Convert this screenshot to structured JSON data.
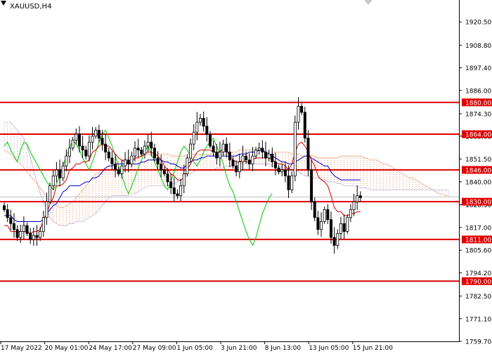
{
  "window": {
    "symbol": "XAUUSD,H4"
  },
  "colors": {
    "background": "#ffffff",
    "axis": "#000000",
    "candle": "#000000",
    "level_line": "#e00000",
    "level_tag_bg": "#e00000",
    "level_tag_text": "#ffffff",
    "current_price_line": "#c0c0c0",
    "current_price_tag_bg": "#e00000",
    "tenkan": "#d00000",
    "kijun": "#0000c8",
    "chikou": "#00c800",
    "senkou_a": "#e89060",
    "senkou_b": "#b098c8"
  },
  "chart_data": {
    "type": "candlestick",
    "title": "XAUUSD,H4",
    "indicator": "Ichimoku Kinko Hyo",
    "ylim": [
      1759.7,
      1928.0
    ],
    "price_ticks": [
      "1920.50",
      "1908.80",
      "1897.40",
      "1886.00",
      "1874.30",
      "1863.00",
      "1851.50",
      "1840.00",
      "1828.50",
      "1817.00",
      "1805.60",
      "1794.20",
      "1782.50",
      "1771.10",
      "1759.70"
    ],
    "time_labels": [
      "17 May 2022",
      "20 May 01:00",
      "24 May 17:00",
      "27 May 09:00",
      "1 Jun 05:00",
      "3 Jun 21:00",
      "8 Jun 13:00",
      "13 Jun 05:00",
      "15 Jun 21:00"
    ],
    "levels": [
      {
        "label": "1880.00",
        "value": 1880.0
      },
      {
        "label": "1864.00",
        "value": 1864.0
      },
      {
        "label": "1846.00",
        "value": 1846.0
      },
      {
        "label": "1830.00",
        "value": 1830.0
      },
      {
        "label": "1811.00",
        "value": 1811.0
      },
      {
        "label": "1790.00",
        "value": 1790.0
      }
    ],
    "current_price": 1832.4,
    "closes": [
      1826,
      1822,
      1819,
      1816,
      1812,
      1815,
      1818,
      1814,
      1811,
      1813,
      1812,
      1815,
      1822,
      1830,
      1838,
      1843,
      1846,
      1842,
      1848,
      1853,
      1857,
      1861,
      1864,
      1858,
      1856,
      1853,
      1860,
      1863,
      1866,
      1862,
      1859,
      1855,
      1852,
      1849,
      1846,
      1844,
      1848,
      1851,
      1849,
      1853,
      1857,
      1856,
      1854,
      1858,
      1860,
      1857,
      1852,
      1849,
      1846,
      1844,
      1840,
      1837,
      1834,
      1833,
      1838,
      1844,
      1852,
      1859,
      1865,
      1870,
      1872,
      1868,
      1864,
      1858,
      1855,
      1852,
      1855,
      1859,
      1855,
      1851,
      1848,
      1845,
      1850,
      1853,
      1851,
      1849,
      1853,
      1856,
      1857,
      1855,
      1852,
      1854,
      1850,
      1847,
      1845,
      1846,
      1843,
      1836,
      1843,
      1870,
      1878,
      1875,
      1862,
      1846,
      1830,
      1822,
      1816,
      1820,
      1826,
      1821,
      1812,
      1808,
      1814,
      1819,
      1815,
      1822,
      1826,
      1830,
      1833,
      1832
    ],
    "tenkan": [
      1818,
      1818,
      1815,
      1815,
      1815,
      1815,
      1815,
      1815,
      1814,
      1815,
      1815,
      1816,
      1821,
      1824,
      1829,
      1832,
      1838,
      1838,
      1839,
      1841,
      1846,
      1847,
      1849,
      1849,
      1850,
      1850,
      1851,
      1855,
      1856,
      1858,
      1859,
      1858,
      1858,
      1856,
      1854,
      1852,
      1851,
      1850,
      1849,
      1850,
      1852,
      1852,
      1853,
      1854,
      1855,
      1855,
      1854,
      1853,
      1851,
      1848,
      1846,
      1844,
      1843,
      1841,
      1841,
      1842,
      1846,
      1849,
      1852,
      1855,
      1856,
      1856,
      1856,
      1856,
      1855,
      1855,
      1855,
      1857,
      1856,
      1853,
      1851,
      1850,
      1850,
      1851,
      1850,
      1850,
      1851,
      1852,
      1852,
      1852,
      1852,
      1852,
      1851,
      1850,
      1849,
      1849,
      1848,
      1846,
      1849,
      1855,
      1859,
      1860,
      1858,
      1855,
      1851,
      1848,
      1843,
      1841,
      1840,
      1838,
      1833,
      1827,
      1825,
      1825,
      1823,
      1823,
      1824,
      1824,
      1825,
      1825
    ],
    "kijun": [
      1823,
      1823,
      1823,
      1821,
      1820,
      1820,
      1820,
      1820,
      1820,
      1820,
      1820,
      1820,
      1821,
      1824,
      1826,
      1828,
      1829,
      1832,
      1835,
      1836,
      1838,
      1838,
      1838,
      1838,
      1839,
      1840,
      1840,
      1842,
      1842,
      1843,
      1845,
      1847,
      1848,
      1848,
      1849,
      1849,
      1849,
      1849,
      1849,
      1849,
      1849,
      1849,
      1850,
      1850,
      1851,
      1851,
      1851,
      1851,
      1851,
      1850,
      1850,
      1849,
      1849,
      1848,
      1847,
      1847,
      1849,
      1850,
      1851,
      1851,
      1852,
      1852,
      1853,
      1853,
      1853,
      1853,
      1853,
      1853,
      1853,
      1853,
      1853,
      1853,
      1854,
      1854,
      1854,
      1855,
      1855,
      1855,
      1856,
      1856,
      1855,
      1854,
      1853,
      1852,
      1851,
      1850,
      1850,
      1849,
      1849,
      1850,
      1851,
      1852,
      1853,
      1853,
      1852,
      1851,
      1850,
      1849,
      1848,
      1848,
      1845,
      1843,
      1842,
      1841,
      1841,
      1841,
      1841,
      1841,
      1841,
      1841
    ],
    "chikou": [
      1858,
      1860,
      1856,
      1853,
      1850,
      1856,
      1860,
      1859,
      1855,
      1852,
      1849,
      1846,
      1843,
      1840,
      1838,
      1836,
      1839,
      1843,
      1848,
      1853,
      1857,
      1861,
      1859,
      1856,
      1852,
      1849,
      1846,
      1850,
      1855,
      1860,
      1864,
      1866,
      1862,
      1858,
      1853,
      1848,
      1843,
      1838,
      1834,
      1838,
      1842,
      1847,
      1851,
      1855,
      1858,
      1854,
      1850,
      1846,
      1842,
      1838,
      1836,
      1840,
      1845,
      1850,
      1855,
      1858,
      1856,
      1853,
      1850,
      1848,
      1851,
      1855,
      1858,
      1860,
      1862,
      1858,
      1854,
      1849,
      1843,
      1838,
      1835,
      1830,
      1825,
      1820,
      1815,
      1811,
      1808,
      1812,
      1818,
      1824,
      1828,
      1832,
      1834
    ],
    "senkou_a": [
      1856,
      1855,
      1854,
      1852,
      1850,
      1849,
      1847,
      1845,
      1843,
      1841,
      1839,
      1837,
      1835,
      1832,
      1830,
      1829,
      1828,
      1827,
      1827,
      1828,
      1829,
      1830,
      1832,
      1834,
      1836,
      1838,
      1840,
      1842,
      1844,
      1845,
      1846,
      1847,
      1848,
      1848,
      1849,
      1850,
      1851,
      1851,
      1852,
      1852,
      1852,
      1853,
      1853,
      1854,
      1854,
      1854,
      1854,
      1854,
      1854,
      1854,
      1854,
      1853,
      1853,
      1853,
      1853,
      1853,
      1854,
      1854,
      1854,
      1854,
      1854,
      1854,
      1854,
      1854,
      1854,
      1854,
      1854,
      1854,
      1854,
      1855,
      1855,
      1855,
      1856,
      1856,
      1856,
      1856,
      1856,
      1856,
      1856,
      1855,
      1855,
      1855,
      1855,
      1855,
      1855,
      1855,
      1855,
      1855,
      1854,
      1854,
      1854,
      1853,
      1853,
      1853,
      1853,
      1853,
      1852,
      1852,
      1852,
      1852,
      1852,
      1852,
      1852,
      1853,
      1853,
      1853,
      1853,
      1853,
      1853,
      1853,
      1852,
      1852,
      1851,
      1851,
      1851,
      1850,
      1849,
      1849,
      1848,
      1847,
      1846,
      1845,
      1844,
      1843,
      1842,
      1842,
      1841,
      1840,
      1839,
      1838,
      1837,
      1836,
      1835,
      1834,
      1834,
      1833,
      1833
    ],
    "senkou_b": [
      1870,
      1870,
      1870,
      1868,
      1866,
      1864,
      1862,
      1858,
      1852,
      1846,
      1840,
      1834,
      1830,
      1826,
      1822,
      1820,
      1819,
      1818,
      1818,
      1818,
      1819,
      1819,
      1820,
      1820,
      1820,
      1821,
      1822,
      1823,
      1824,
      1826,
      1828,
      1830,
      1832,
      1833,
      1833,
      1833,
      1833,
      1833,
      1833,
      1834,
      1834,
      1835,
      1836,
      1837,
      1838,
      1838,
      1838,
      1838,
      1838,
      1838,
      1838,
      1839,
      1839,
      1840,
      1841,
      1842,
      1843,
      1844,
      1845,
      1846,
      1846,
      1846,
      1846,
      1846,
      1846,
      1847,
      1847,
      1847,
      1848,
      1848,
      1848,
      1848,
      1849,
      1849,
      1849,
      1849,
      1849,
      1849,
      1849,
      1849,
      1849,
      1849,
      1848,
      1848,
      1848,
      1847,
      1847,
      1846,
      1846,
      1845,
      1845,
      1844,
      1843,
      1843,
      1842,
      1842,
      1842,
      1841,
      1841,
      1840,
      1840,
      1840,
      1839,
      1839,
      1838,
      1838,
      1838,
      1838,
      1838,
      1837,
      1837,
      1837,
      1836,
      1836,
      1836,
      1836,
      1836,
      1836,
      1836,
      1836,
      1836,
      1836,
      1836,
      1836,
      1836,
      1836,
      1836,
      1836,
      1836,
      1836,
      1836,
      1836,
      1836,
      1836,
      1836,
      1836,
      1836
    ]
  }
}
